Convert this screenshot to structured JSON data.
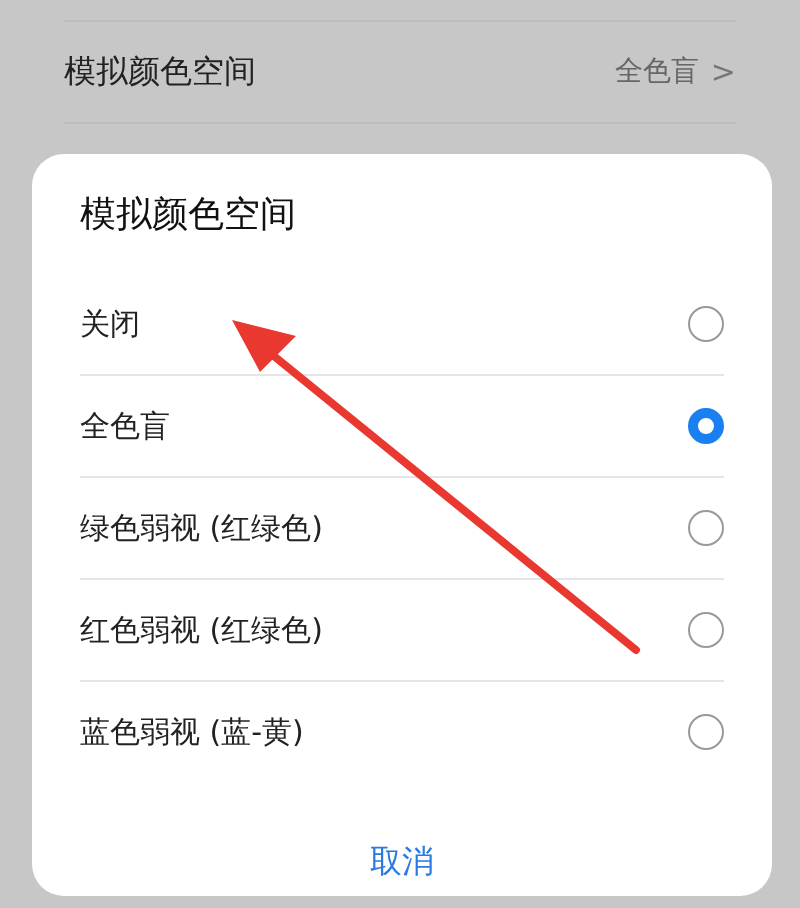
{
  "settings": [
    {
      "label": "模拟颜色空间",
      "value": "全色盲",
      "chevron": ">"
    }
  ],
  "dialog": {
    "title": "模拟颜色空间",
    "options": [
      {
        "label": "关闭",
        "selected": false
      },
      {
        "label": "全色盲",
        "selected": true
      },
      {
        "label": "绿色弱视 (红绿色)",
        "selected": false
      },
      {
        "label": "红色弱视 (红绿色)",
        "selected": false
      },
      {
        "label": "蓝色弱视 (蓝-黄)",
        "selected": false
      }
    ],
    "cancel": "取消"
  }
}
